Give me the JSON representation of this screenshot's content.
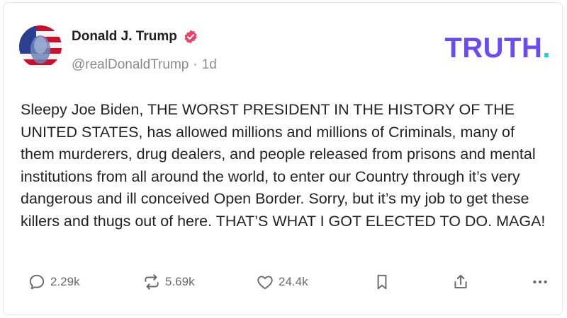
{
  "account": {
    "display_name": "Donald J. Trump",
    "handle": "@realDonaldTrump",
    "separator": "·",
    "time": "1d",
    "verified_icon": "verified-badge-icon"
  },
  "brand": {
    "logo_text": "TRUTH",
    "logo_dot": ".",
    "accent": "#6b4bf5",
    "dot_color": "#19d6b8",
    "badge_color": "#e8436b"
  },
  "post": {
    "text": "Sleepy Joe Biden, THE WORST PRESIDENT IN THE HISTORY OF THE UNITED STATES, has allowed millions and millions of Criminals, many of them murderers, drug dealers, and people released from prisons and mental institutions from all around the world, to enter our Country through it’s very dangerous and ill conceived Open Border. Sorry, but it’s my job to get these killers and thugs out of here. THAT’S WHAT I GOT ELECTED TO DO. MAGA!"
  },
  "actions": {
    "replies": "2.29k",
    "retruths": "5.69k",
    "likes": "24.4k"
  }
}
